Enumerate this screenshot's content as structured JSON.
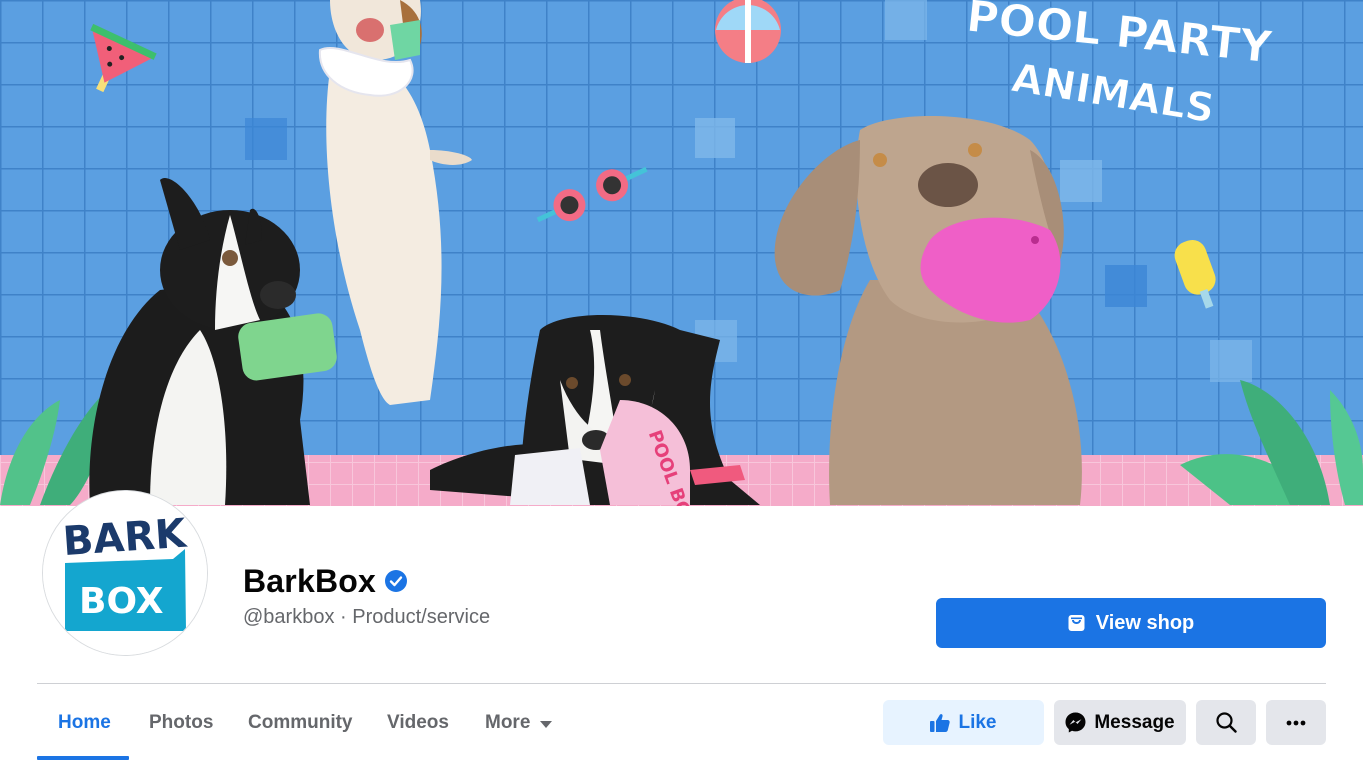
{
  "cover": {
    "headline_line1": "POOL PARTY",
    "headline_line2": "ANIMALS",
    "bag_text": "POOL BO"
  },
  "profile": {
    "logo_top": "BARK",
    "logo_bottom": "BOX",
    "name": "BarkBox",
    "subtitle": "@barkbox · Product/service",
    "verified_icon": "verified-badge-icon",
    "view_shop_label": "View shop",
    "shop_icon": "shop-bag-icon"
  },
  "tabs": [
    {
      "label": "Home",
      "active": true
    },
    {
      "label": "Photos",
      "active": false
    },
    {
      "label": "Community",
      "active": false
    },
    {
      "label": "Videos",
      "active": false
    },
    {
      "label": "More",
      "active": false
    }
  ],
  "actions": {
    "like_label": "Like",
    "message_label": "Message",
    "search_icon": "search-icon",
    "more_icon": "more-dots-icon"
  },
  "colors": {
    "accent": "#1b74e4",
    "pool_blue": "#5a9ee0",
    "tile_pink": "#f4a7c6",
    "logo_navy": "#1b3a6b",
    "logo_teal": "#14a6cf"
  }
}
